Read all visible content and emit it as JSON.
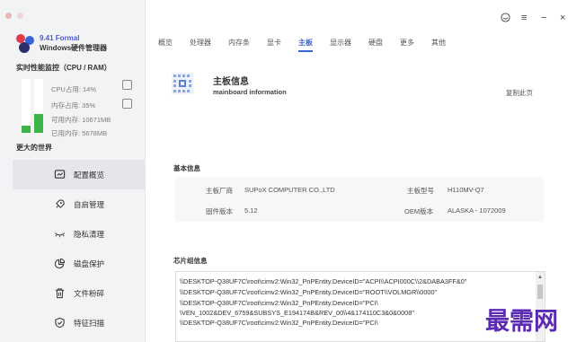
{
  "app": {
    "version": "9.41 Formal",
    "name": "Windows硬件管理器"
  },
  "titlebar": {
    "settings_icon": "smile-icon",
    "menu_icon": "≡",
    "minimize_icon": "−",
    "close_icon": "×"
  },
  "monitor": {
    "title": "实时性能监控（CPU / RAM）",
    "cpu_fraction": 0.14,
    "mem_fraction": 0.35,
    "cpu_label": "CPU占用: 14%",
    "mem_label": "内存占用: 35%",
    "avail_mem": "可用内存: 10671MB",
    "used_mem": "已用内存: 5678MB"
  },
  "more_title": "更大的世界",
  "nav": [
    {
      "label": "配置概览",
      "icon": "overview-icon"
    },
    {
      "label": "自启管理",
      "icon": "rocket-icon"
    },
    {
      "label": "隐私清理",
      "icon": "eye-icon"
    },
    {
      "label": "磁盘保护",
      "icon": "pie-chart-icon"
    },
    {
      "label": "文件粉碎",
      "icon": "trash-icon"
    },
    {
      "label": "特征扫描",
      "icon": "shield-check-icon"
    }
  ],
  "tabs": [
    "概览",
    "处理器",
    "内存条",
    "显卡",
    "主板",
    "显示器",
    "硬盘",
    "更多",
    "其他"
  ],
  "board": {
    "title": "主板信息",
    "subtitle": "mainboard information",
    "copy_label": "复制此页"
  },
  "basic": {
    "label": "基本信息",
    "manufacturer_key": "主板厂商",
    "manufacturer_val": "SUPoX COMPUTER CO.,LTD",
    "model_key": "主板型号",
    "model_val": "H110MV-Q7",
    "firmware_key": "固件版本",
    "firmware_val": "5.12",
    "oem_key": "OEM版本",
    "oem_val": "ALASKA - 1072009"
  },
  "chipset": {
    "label": "芯片组信息",
    "lines": [
      "\\\\DESKTOP-Q38UF7C\\root\\cimv2:Win32_PnPEntity.DeviceID=\"ACPI\\\\ACPI000C\\\\2&DABA3FF&0\"",
      "\\\\DESKTOP-Q38UF7C\\root\\cimv2:Win32_PnPEntity.DeviceID=\"ROOT\\\\VOLMGR\\\\0000\"",
      "\\\\DESKTOP-Q38UF7C\\root\\cimv2:Win32_PnPEntity.DeviceID=\"PCI\\",
      "\\VEN_1002&DEV_6759&SUBSYS_E194174B&REV_00\\\\4&174110C3&0&0008\"",
      "\\\\DESKTOP-Q38UF7C\\root\\cimv2:Win32_PnPEntity.DeviceID=\"PCI\\"
    ]
  },
  "watermark": "最需网"
}
